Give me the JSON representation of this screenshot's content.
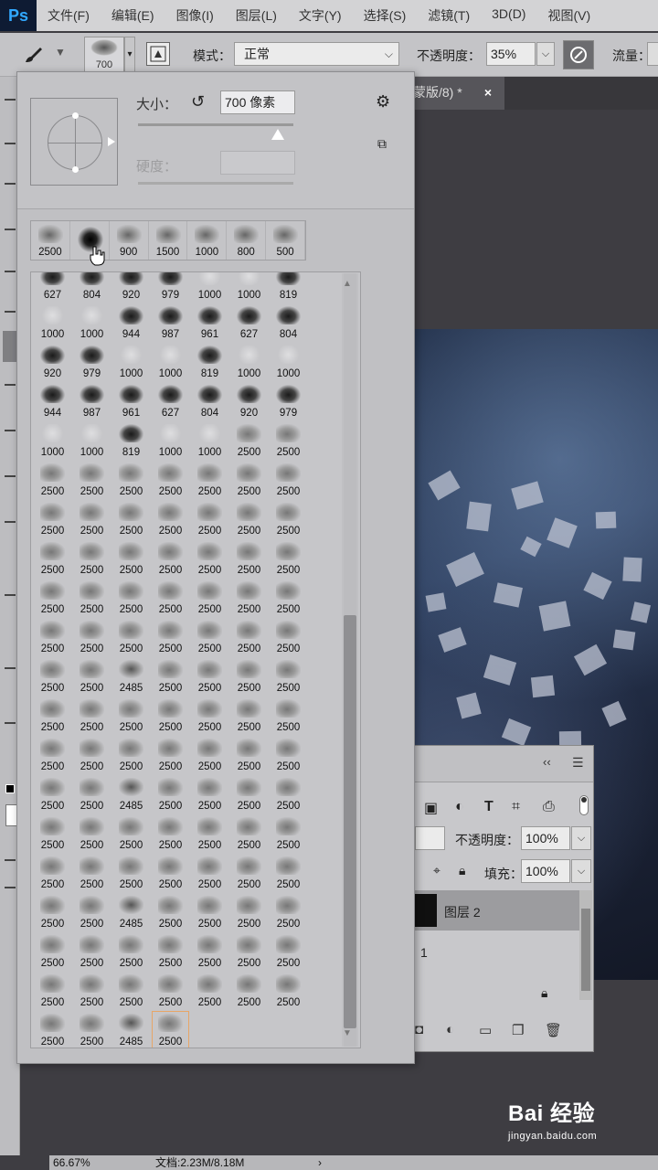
{
  "app": {
    "logo": "Ps"
  },
  "menu": [
    "文件(F)",
    "编辑(E)",
    "图像(I)",
    "图层(L)",
    "文字(Y)",
    "选择(S)",
    "滤镜(T)",
    "3D(D)",
    "视图(V)"
  ],
  "options_bar": {
    "brush_size": "700",
    "mode_label": "模式：",
    "mode_value": "正常",
    "opacity_label": "不透明度：",
    "opacity_value": "35%",
    "flow_label": "流量："
  },
  "document": {
    "tab_title": "蒙版/8) *",
    "tab_close": "×"
  },
  "brush_picker": {
    "size_label": "大小：",
    "size_value": "700 像素",
    "hardness_label": "硬度：",
    "recent": [
      "2500",
      "",
      "900",
      "1500",
      "1000",
      "800",
      "500"
    ],
    "rows": [
      [
        "627",
        "804",
        "920",
        "979",
        "1000",
        "1000",
        "819"
      ],
      [
        "1000",
        "1000",
        "944",
        "987",
        "961",
        "627",
        "804"
      ],
      [
        "920",
        "979",
        "1000",
        "1000",
        "819",
        "1000",
        "1000"
      ],
      [
        "944",
        "987",
        "961",
        "627",
        "804",
        "920",
        "979"
      ],
      [
        "1000",
        "1000",
        "819",
        "1000",
        "1000",
        "2500",
        "2500"
      ],
      [
        "2500",
        "2500",
        "2500",
        "2500",
        "2500",
        "2500",
        "2500"
      ],
      [
        "2500",
        "2500",
        "2500",
        "2500",
        "2500",
        "2500",
        "2500"
      ],
      [
        "2500",
        "2500",
        "2500",
        "2500",
        "2500",
        "2500",
        "2500"
      ],
      [
        "2500",
        "2500",
        "2500",
        "2500",
        "2500",
        "2500",
        "2500"
      ],
      [
        "2500",
        "2500",
        "2500",
        "2500",
        "2500",
        "2500",
        "2500"
      ],
      [
        "2500",
        "2500",
        "2485",
        "2500",
        "2500",
        "2500",
        "2500"
      ],
      [
        "2500",
        "2500",
        "2500",
        "2500",
        "2500",
        "2500",
        "2500"
      ],
      [
        "2500",
        "2500",
        "2500",
        "2500",
        "2500",
        "2500",
        "2500"
      ],
      [
        "2500",
        "2500",
        "2485",
        "2500",
        "2500",
        "2500",
        "2500"
      ],
      [
        "2500",
        "2500",
        "2500",
        "2500",
        "2500",
        "2500",
        "2500"
      ],
      [
        "2500",
        "2500",
        "2500",
        "2500",
        "2500",
        "2500",
        "2500"
      ],
      [
        "2500",
        "2500",
        "2485",
        "2500",
        "2500",
        "2500",
        "2500"
      ],
      [
        "2500",
        "2500",
        "2500",
        "2500",
        "2500",
        "2500",
        "2500"
      ],
      [
        "2500",
        "2500",
        "2500",
        "2500",
        "2500",
        "2500",
        "2500"
      ],
      [
        "2500",
        "2500",
        "2485",
        "2500"
      ]
    ]
  },
  "layers_panel": {
    "collapse": "‹‹",
    "opacity_label": "不透明度：",
    "opacity_value": "100%",
    "fill_label": "填充：",
    "fill_value": "100%",
    "active_layer": "图层 2",
    "second_row": "1"
  },
  "status": {
    "zoom": "66.67%",
    "doc": "文档:2.23M/8.18M",
    "arrow": "›"
  },
  "watermark": {
    "logo": "Bai 经验",
    "url": "jingyan.baidu.com"
  }
}
